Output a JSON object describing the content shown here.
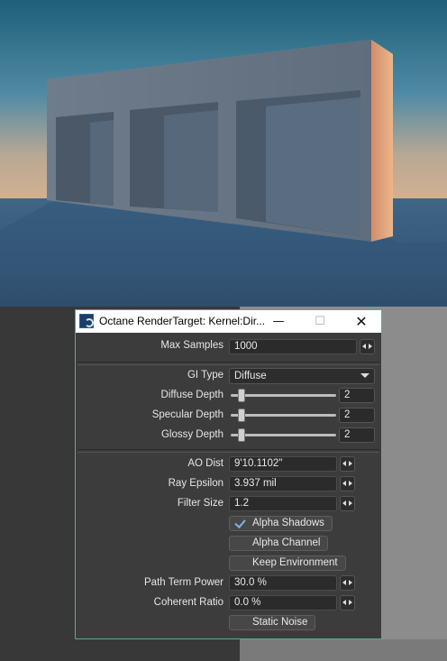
{
  "window": {
    "title": "Octane RenderTarget: Kernel:Dir...",
    "minimize_label": "—",
    "maximize_label": "☐",
    "close_label": "✕"
  },
  "colors": {
    "accent": "#5aa7a0",
    "check": "#7fb3e8",
    "panel_bg": "#3c3c3c",
    "field_bg": "#2b2b2b"
  },
  "fields": {
    "max_samples": {
      "label": "Max Samples",
      "value": "1000"
    },
    "gi_type": {
      "label": "GI Type",
      "value": "Diffuse"
    },
    "diffuse_depth": {
      "label": "Diffuse Depth",
      "value": "2"
    },
    "specular_depth": {
      "label": "Specular Depth",
      "value": "2"
    },
    "glossy_depth": {
      "label": "Glossy Depth",
      "value": "2"
    },
    "ao_dist": {
      "label": "AO Dist",
      "value": "9'10.1102\""
    },
    "ray_epsilon": {
      "label": "Ray Epsilon",
      "value": "3.937 mil"
    },
    "filter_size": {
      "label": "Filter Size",
      "value": "1.2"
    },
    "path_term_power": {
      "label": "Path Term Power",
      "value": "30.0 %"
    },
    "coherent_ratio": {
      "label": "Coherent Ratio",
      "value": "0.0 %"
    }
  },
  "toggles": {
    "alpha_shadows": {
      "label": "Alpha Shadows",
      "checked": true
    },
    "alpha_channel": {
      "label": "Alpha Channel",
      "checked": false
    },
    "keep_environment": {
      "label": "Keep Environment",
      "checked": false
    },
    "static_noise": {
      "label": "Static Noise",
      "checked": false
    }
  },
  "icons": {
    "app": "octane-app-icon",
    "stepper": "stepper-arrows-icon",
    "dropdown": "chevron-down-icon",
    "check": "checkmark-icon"
  }
}
